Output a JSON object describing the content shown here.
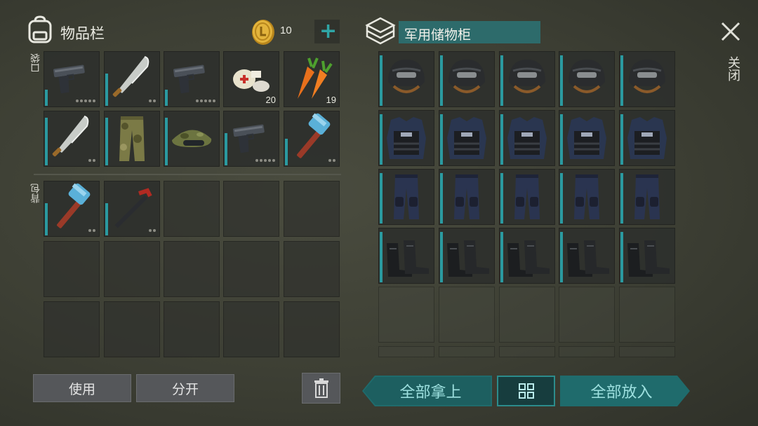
{
  "inventory": {
    "title": "物品栏",
    "coins": "10",
    "pocket_label": "口袋",
    "backpack_label": "背包",
    "pocket_slots": [
      {
        "item": "pistol",
        "qty": "",
        "dots": 5,
        "durability": 0.3
      },
      {
        "item": "machete",
        "qty": "",
        "dots": 2,
        "durability": 0.6
      },
      {
        "item": "pistol",
        "qty": "",
        "dots": 5,
        "durability": 0.3
      },
      {
        "item": "bandage",
        "qty": "20",
        "dots": 0,
        "durability": 0
      },
      {
        "item": "carrots",
        "qty": "19",
        "dots": 0,
        "durability": 0
      },
      {
        "item": "machete",
        "qty": "",
        "dots": 2,
        "durability": 0.9
      },
      {
        "item": "camo-pants",
        "qty": "",
        "dots": 0,
        "durability": 0.9
      },
      {
        "item": "camo-cap",
        "qty": "",
        "dots": 0,
        "durability": 0.9
      },
      {
        "item": "pistol",
        "qty": "",
        "dots": 5,
        "durability": 0.6
      },
      {
        "item": "hammer",
        "qty": "",
        "dots": 2,
        "durability": 0.5
      }
    ],
    "backpack_slots": [
      {
        "item": "hammer",
        "qty": "",
        "dots": 2,
        "durability": 0.6
      },
      {
        "item": "crowbar",
        "qty": "",
        "dots": 2,
        "durability": 0.6
      }
    ],
    "use_label": "使用",
    "split_label": "分开"
  },
  "storage": {
    "title": "军用储物柜",
    "rows": [
      {
        "item": "helmet",
        "count": 5
      },
      {
        "item": "vest",
        "count": 5
      },
      {
        "item": "swat-pants",
        "count": 5
      },
      {
        "item": "boots",
        "count": 5
      }
    ],
    "take_all_label": "全部拿上",
    "put_all_label": "全部放入"
  },
  "close_label": "关闭",
  "colors": {
    "accent": "#2a9aa0",
    "button_teal": "#1f6b6c",
    "text_teal": "#9de0df"
  }
}
